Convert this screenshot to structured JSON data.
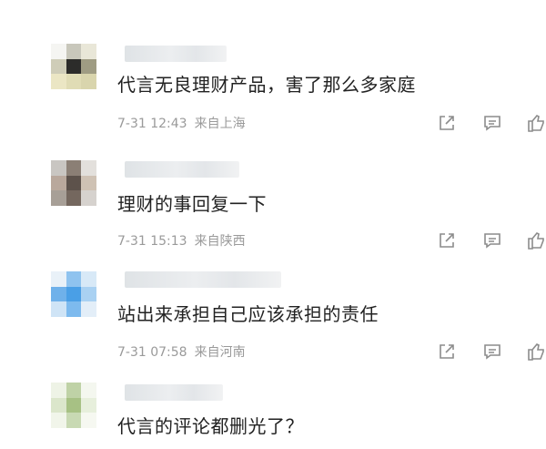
{
  "comments": [
    {
      "text": "代言无良理财产品，害了那么多家庭",
      "time": "7-31 12:43",
      "location": "来自上海",
      "avatar_colors": [
        "#f5f5f2",
        "#c8c7bb",
        "#e9e7d8",
        "#cfcdb8",
        "#2c2c2a",
        "#9f9c83",
        "#ebe6c4",
        "#e0dcb5",
        "#d9d5ad"
      ]
    },
    {
      "text": "理财的事回复一下",
      "time": "7-31 15:13",
      "location": "来自陕西",
      "avatar_colors": [
        "#c9c6c2",
        "#8b7f75",
        "#e3e0dc",
        "#b9a89c",
        "#5d524b",
        "#cfc2b4",
        "#a79f97",
        "#74675e",
        "#d6d2ce"
      ]
    },
    {
      "text": "站出来承担自己应该承担的责任",
      "time": "7-31 07:58",
      "location": "来自河南",
      "avatar_colors": [
        "#e9f1f8",
        "#8fc3ef",
        "#d8e9f7",
        "#6fb1ea",
        "#4a9fe6",
        "#a9d1f2",
        "#cfe4f6",
        "#7dbaee",
        "#e3eef8"
      ]
    },
    {
      "text": "代言的评论都删光了？",
      "time": "",
      "location": "",
      "avatar_colors": [
        "#eef3e6",
        "#bfd2a6",
        "#f4f7ef",
        "#dbe6cb",
        "#a7c184",
        "#e7efdc",
        "#f1f5ea",
        "#c8d9b3",
        "#f6f8f1"
      ]
    }
  ],
  "actions": {
    "share_icon": "share-icon",
    "comment_icon": "comment-icon",
    "like_icon": "like-icon"
  }
}
